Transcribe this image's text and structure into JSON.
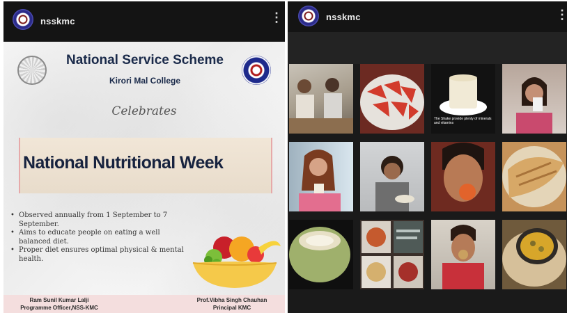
{
  "left_post": {
    "account_name": "nsskmc",
    "menu_icon": "more-vertical-icon",
    "poster": {
      "organization": "National Service Scheme",
      "college": "Kirori Mal College",
      "celebrates": "Celebrates",
      "event": "National Nutritional Week",
      "points": [
        "Observed annually from 1 September to 7 September.",
        "Aims to educate people on eating a well balanced diet.",
        "Proper diet ensures optimal physical & mental health."
      ],
      "signatory_left_name": "Ram Sunil Kumar Lalji",
      "signatory_left_role": "Programme Officer,NSS-KMC",
      "signatory_right_name": "Prof.Vibha Singh Chauhan",
      "signatory_right_role": "Principal KMC"
    }
  },
  "right_post": {
    "account_name": "nsskmc",
    "menu_icon": "more-vertical-icon",
    "collage_tiles": [
      {
        "subject": "two people eating at a table"
      },
      {
        "subject": "plate of sliced red fruit"
      },
      {
        "subject": "glass of milk",
        "caption": "The Shake provide plenty of minerals and vitamins"
      },
      {
        "subject": "girl drinking from glass"
      },
      {
        "subject": "girl holding drink"
      },
      {
        "subject": "boy eating"
      },
      {
        "subject": "boy biting fruit"
      },
      {
        "subject": "paratha on plate"
      },
      {
        "subject": "tender coconut"
      },
      {
        "subject": "meal collage with text"
      },
      {
        "subject": "boy eating snack"
      },
      {
        "subject": "curry with roti"
      }
    ]
  }
}
